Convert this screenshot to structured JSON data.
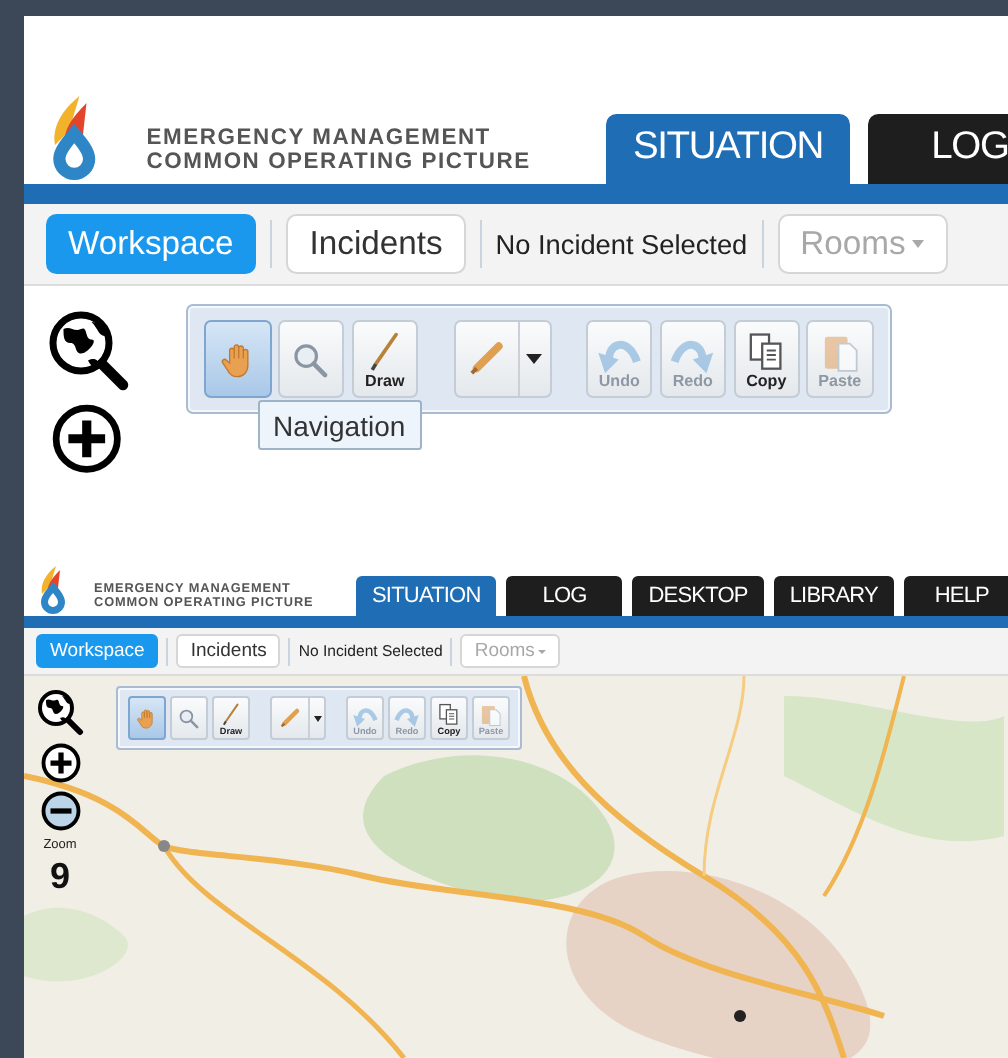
{
  "zoomed_view": {
    "kind": "detail",
    "logo": {
      "line_1": "EMERGENCY MANAGEMENT",
      "line_2": "COMMON OPERATING PICTURE"
    },
    "tabs": [
      {
        "label": "SITUATION",
        "selected": true
      },
      {
        "label": "LOG",
        "selected": false
      }
    ],
    "toolbar": {
      "workspace": "Workspace",
      "incidents": "Incidents",
      "incident_status": "No Incident Selected",
      "rooms": {
        "label": "Rooms",
        "disabled": true
      }
    },
    "map_controls": [
      {
        "kind": "search-globe"
      },
      {
        "kind": "zoom-in"
      }
    ],
    "tool_groups": [
      {
        "tools": [
          {
            "kind": "hand",
            "selected": true,
            "disabled": false
          },
          {
            "kind": "magnifier",
            "selected": false,
            "disabled": false
          },
          {
            "kind": "draw",
            "label": "Draw",
            "selected": false,
            "disabled": false
          }
        ]
      },
      {
        "tools": [
          {
            "kind": "pencil-menu",
            "selected": false,
            "disabled": false
          }
        ]
      },
      {
        "tools": [
          {
            "kind": "undo",
            "label": "Undo",
            "selected": false,
            "disabled": true
          },
          {
            "kind": "redo",
            "label": "Redo",
            "selected": false,
            "disabled": true
          },
          {
            "kind": "copy",
            "label": "Copy",
            "selected": false,
            "disabled": false
          },
          {
            "kind": "paste",
            "label": "Paste",
            "selected": false,
            "disabled": true
          }
        ]
      }
    ],
    "tooltip": "Navigation"
  },
  "full_view": {
    "kind": "map",
    "logo": {
      "line_1": "EMERGENCY MANAGEMENT",
      "line_2": "COMMON OPERATING PICTURE"
    },
    "tabs": [
      {
        "label": "SITUATION",
        "selected": true
      },
      {
        "label": "LOG",
        "selected": false
      },
      {
        "label": "DESKTOP",
        "selected": false
      },
      {
        "label": "LIBRARY",
        "selected": false
      },
      {
        "label": "HELP",
        "selected": false
      }
    ],
    "toolbar": {
      "workspace": "Workspace",
      "incidents": "Incidents",
      "incident_status": "No Incident Selected",
      "rooms": {
        "label": "Rooms",
        "disabled": true
      }
    },
    "map_controls": [
      {
        "kind": "search-globe"
      },
      {
        "kind": "zoom-in"
      },
      {
        "kind": "zoom-out"
      }
    ],
    "zoom": {
      "label": "Zoom",
      "value": "9"
    },
    "tool_groups": [
      {
        "tools": [
          {
            "kind": "hand",
            "selected": true,
            "disabled": false
          },
          {
            "kind": "magnifier",
            "selected": false,
            "disabled": false
          },
          {
            "kind": "draw",
            "label": "Draw",
            "selected": false,
            "disabled": false
          }
        ]
      },
      {
        "tools": [
          {
            "kind": "pencil-menu",
            "selected": false,
            "disabled": false
          }
        ]
      },
      {
        "tools": [
          {
            "kind": "undo",
            "label": "Undo",
            "selected": false,
            "disabled": true
          },
          {
            "kind": "redo",
            "label": "Redo",
            "selected": false,
            "disabled": true
          },
          {
            "kind": "copy",
            "label": "Copy",
            "selected": false,
            "disabled": false
          },
          {
            "kind": "paste",
            "label": "Paste",
            "selected": false,
            "disabled": true
          }
        ]
      }
    ]
  }
}
